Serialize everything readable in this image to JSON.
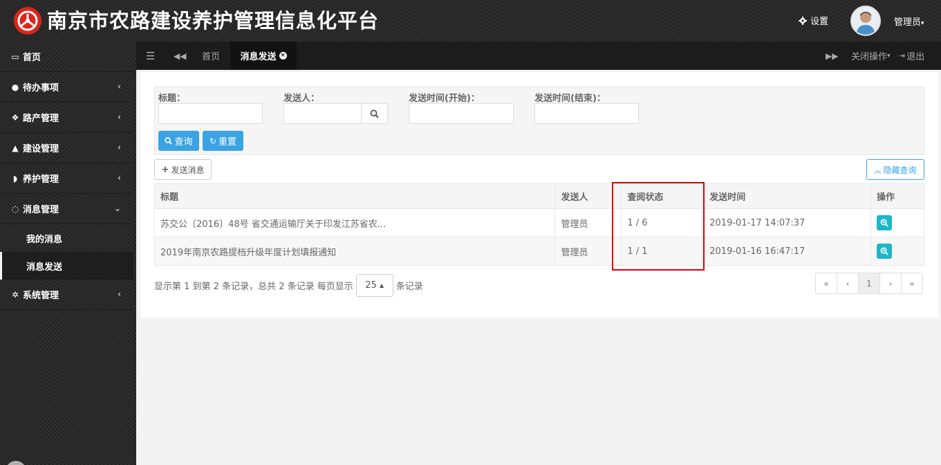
{
  "header": {
    "title": "南京市农路建设养护管理信息化平台",
    "settings_label": "设置",
    "user_label": "管理员",
    "brand_color": "#d9261c"
  },
  "sidebar": {
    "items": [
      {
        "label": "首页",
        "icon": "monitor-icon"
      },
      {
        "label": "待办事项",
        "icon": "comments-icon"
      },
      {
        "label": "路产管理",
        "icon": "cubes-icon"
      },
      {
        "label": "建设管理",
        "icon": "road-icon"
      },
      {
        "label": "养护管理",
        "icon": "shield-icon"
      },
      {
        "label": "消息管理",
        "icon": "chat-icon"
      },
      {
        "label": "系统管理",
        "icon": "gears-icon"
      }
    ],
    "subitems": [
      {
        "label": "我的消息"
      },
      {
        "label": "消息发送"
      }
    ]
  },
  "tabs": {
    "home": "首页",
    "active": "消息发送",
    "close_ops": "关闭操作",
    "logout": "退出"
  },
  "search": {
    "title_label": "标题：",
    "sender_label": "发送人：",
    "start_label": "发送时间(开始)：",
    "end_label": "发送时间(结束)：",
    "query_btn": "查询",
    "reset_btn": "重置"
  },
  "toolbar": {
    "send_btn": "发送消息",
    "hide_btn": "隐藏查询"
  },
  "table": {
    "headers": [
      "标题",
      "发送人",
      "查阅状态",
      "发送时间",
      "操作"
    ],
    "rows": [
      {
        "title": "苏交公〔2016〕48号 省交通运输厅关于印发江苏省农...",
        "sender": "管理员",
        "status": "1 / 6",
        "time": "2019-01-17 14:07:37"
      },
      {
        "title": "2019年南京农路提档升级年度计划填报通知",
        "sender": "管理员",
        "status": "1 / 1",
        "time": "2019-01-16 16:47:17"
      }
    ]
  },
  "pagination": {
    "info_prefix": "显示第 1 到第 2 条记录，总共 2 条记录 每页显示",
    "page_size": "25",
    "info_suffix": "条记录",
    "first": "«",
    "prev": "‹",
    "current": "1",
    "next": "›",
    "last": "»"
  }
}
